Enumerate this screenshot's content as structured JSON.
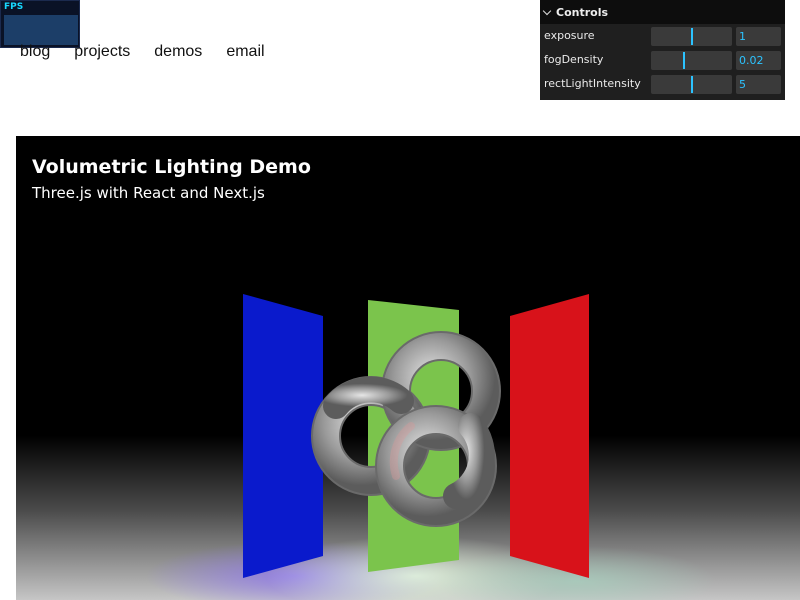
{
  "fps_widget": {
    "label": "FPS"
  },
  "nav": {
    "items": [
      "blog",
      "projects",
      "demos",
      "email"
    ]
  },
  "gui": {
    "title": "Controls",
    "controls": [
      {
        "label": "exposure",
        "value": "1",
        "level": 0.5
      },
      {
        "label": "fogDensity",
        "value": "0.02",
        "level": 0.4
      },
      {
        "label": "rectLightIntensity",
        "value": "5",
        "level": 0.5
      }
    ]
  },
  "demo": {
    "title": "Volumetric Lighting Demo",
    "subtitle": "Three.js with React and Next.js"
  },
  "colors": {
    "panel_blue": "#0a1acc",
    "panel_green": "#7bc44c",
    "panel_red": "#d8121a",
    "gui_accent": "#2cc3ff",
    "fps_text": "#17d8ff"
  },
  "icons": [
    "chevron-down-icon"
  ]
}
